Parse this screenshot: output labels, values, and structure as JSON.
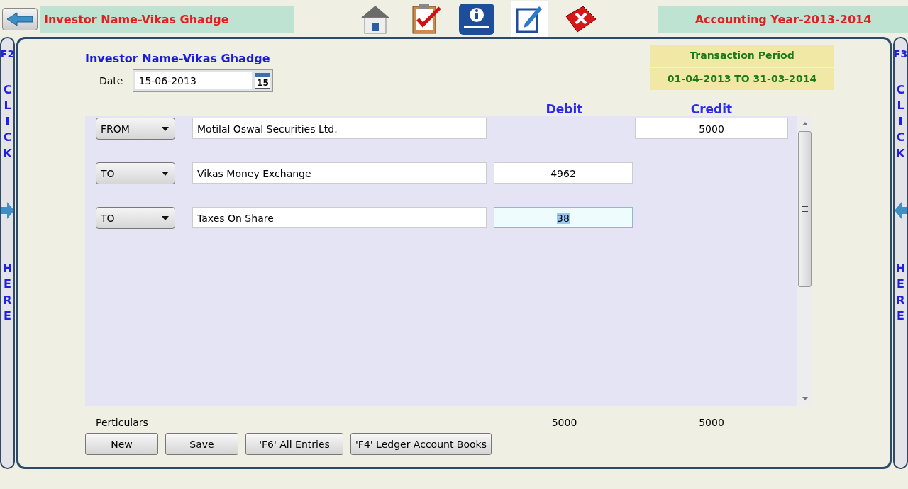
{
  "header": {
    "investor": "Investor Name-Vikas Ghadge",
    "accounting_year": "Accounting Year-2013-2014"
  },
  "side_left": {
    "key": "F2",
    "top": "CLICK",
    "bottom": "HERE"
  },
  "side_right": {
    "key": "F3",
    "top": "CLICK",
    "bottom": "HERE"
  },
  "form": {
    "title": "Investor Name-Vikas Ghadge",
    "date_label": "Date",
    "date": "15-06-2013",
    "calendar_day": "15",
    "period_title": "Transaction Period",
    "period": "01-04-2013  TO  31-03-2014",
    "debit_heading": "Debit",
    "credit_heading": "Credit"
  },
  "entries": [
    {
      "direction": "FROM",
      "account": "Motilal Oswal Securities Ltd.",
      "credit": "5000",
      "focused": false
    },
    {
      "direction": "TO",
      "account": "Vikas Money Exchange",
      "debit": "4962",
      "focused": false
    },
    {
      "direction": "TO",
      "account": "Taxes On Share",
      "debit": "38",
      "focused": true
    }
  ],
  "footer": {
    "label": "Perticulars",
    "debit_total": "5000",
    "credit_total": "5000"
  },
  "buttons": [
    "New",
    "Save",
    "'F6' All Entries",
    "'F4' Ledger Account Books"
  ]
}
